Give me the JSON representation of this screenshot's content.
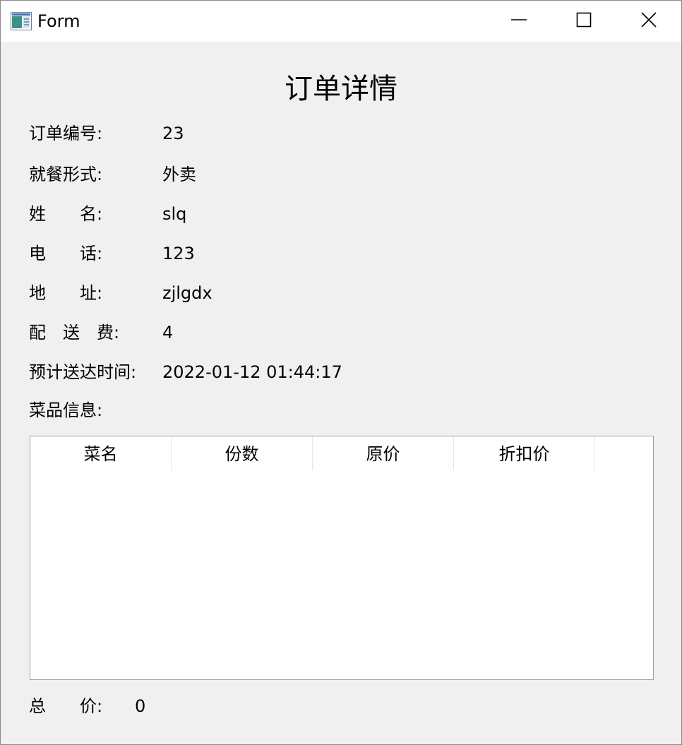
{
  "window": {
    "title": "Form"
  },
  "icons": {
    "app": "form-app-icon",
    "minimize": "minimize-icon",
    "maximize": "maximize-icon",
    "close": "close-icon"
  },
  "heading": "订单详情",
  "fields": [
    {
      "label": "订单编号:",
      "value": "23"
    },
    {
      "label": "就餐形式:",
      "value": "外卖"
    },
    {
      "label": "姓　　名:",
      "value": "slq"
    },
    {
      "label": "电　　话:",
      "value": "123"
    },
    {
      "label": "地　　址:",
      "value": "zjlgdx"
    },
    {
      "label": "配　送　费:",
      "value": "4"
    },
    {
      "label": "预计送达时间:",
      "value": "2022-01-12 01:44:17"
    }
  ],
  "dishes": {
    "label": "菜品信息:",
    "columns": [
      "菜名",
      "份数",
      "原价",
      "折扣价"
    ],
    "rows": []
  },
  "total": {
    "label": "总　　价:",
    "value": "0"
  }
}
